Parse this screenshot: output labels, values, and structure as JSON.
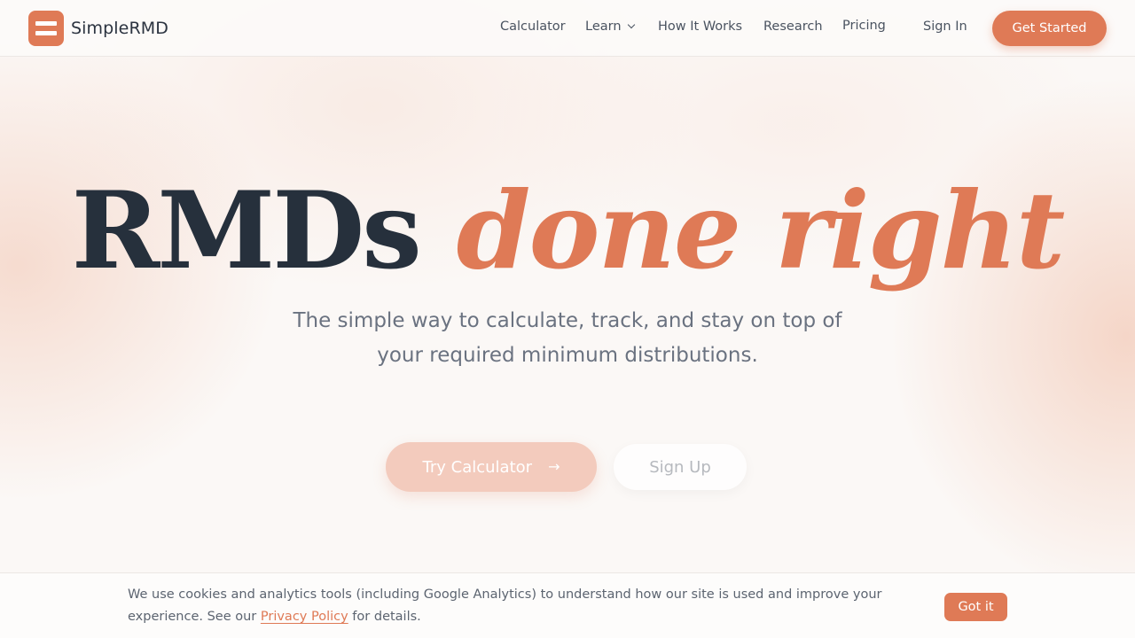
{
  "brand": {
    "name": "SimpleRMD"
  },
  "nav": {
    "items": [
      {
        "label": "Calculator"
      },
      {
        "label": "Learn"
      },
      {
        "label": "How It Works"
      },
      {
        "label": "Research"
      },
      {
        "label": "Pricing"
      }
    ],
    "sign_in": "Sign In",
    "cta": "Get Started"
  },
  "hero": {
    "title_main": "RMDs",
    "title_accent": "done right",
    "subtitle_line1": "The simple way to calculate, track, and stay on top of",
    "subtitle_line2": "your required minimum distributions.",
    "primary_button": "Try Calculator",
    "secondary_button": "Sign Up"
  },
  "cookie": {
    "text_before": "We use cookies and analytics tools (including Google Analytics) to understand how our site is used and improve your experience. See our ",
    "link": "Privacy Policy",
    "text_after": " for details.",
    "button": "Got it"
  },
  "colors": {
    "accent": "#df7a56",
    "dark": "#26303c"
  },
  "icons": {
    "logo": "stacked-bars-logo-icon",
    "dropdown": "chevron-down-icon",
    "arrow": "arrow-right-icon"
  }
}
